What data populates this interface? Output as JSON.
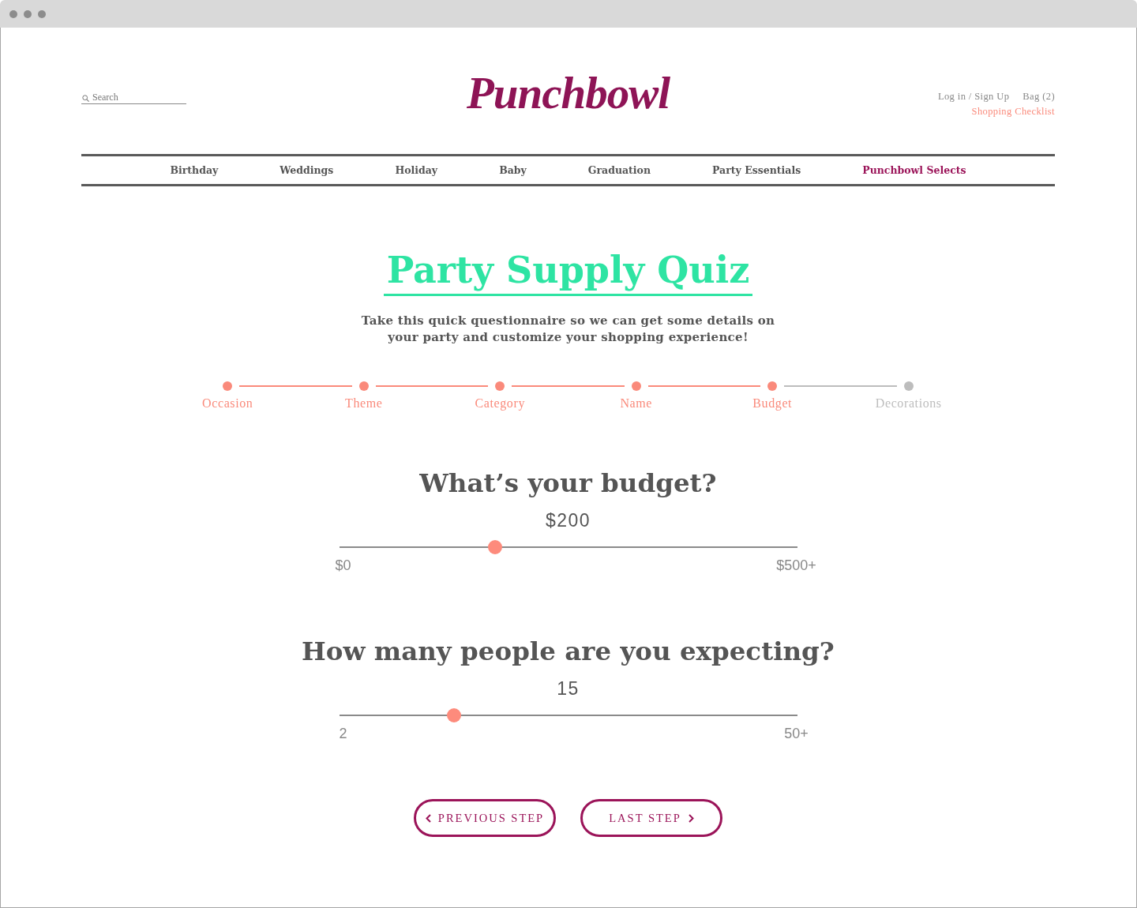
{
  "header": {
    "search": {
      "placeholder": "Search"
    },
    "logo": "Punchbowl",
    "account_links": [
      "Log in / Sign Up",
      "Bag (2)"
    ],
    "checklist_link": "Shopping Checklist"
  },
  "nav": [
    {
      "label": "Birthday",
      "selected": false
    },
    {
      "label": "Weddings",
      "selected": false
    },
    {
      "label": "Holiday",
      "selected": false
    },
    {
      "label": "Baby",
      "selected": false
    },
    {
      "label": "Graduation",
      "selected": false
    },
    {
      "label": "Party Essentials",
      "selected": false
    },
    {
      "label": "Punchbowl Selects",
      "selected": true
    }
  ],
  "quiz": {
    "title": "Party Supply Quiz",
    "intro": "Take this quick questionnaire so we can get some details on your party and customize your shopping experience!",
    "steps": [
      {
        "label": "Occasion",
        "reached": true
      },
      {
        "label": "Theme",
        "reached": true
      },
      {
        "label": "Category",
        "reached": true
      },
      {
        "label": "Name",
        "reached": true
      },
      {
        "label": "Budget",
        "reached": true
      },
      {
        "label": "Decorations",
        "reached": false
      }
    ],
    "questions": [
      {
        "question": "What’s your budget?",
        "value": "$200",
        "level": 0.34,
        "min_label": "$0",
        "max_label": "$500+"
      },
      {
        "question": "How many people are you expecting?",
        "value": "15",
        "level": 0.25,
        "min_label": "2",
        "max_label": "50+"
      }
    ],
    "buttons": [
      {
        "label": "PREVIOUS STEP",
        "kind": "back"
      },
      {
        "label": "LAST STEP",
        "kind": "next"
      }
    ]
  }
}
